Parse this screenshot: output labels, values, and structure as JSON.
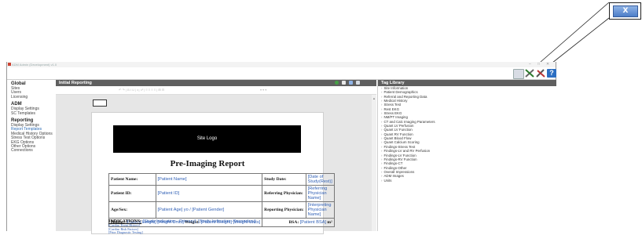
{
  "callout": {
    "close_label": "X"
  },
  "window": {
    "title": "ADM Admin (Development) v1.0",
    "minimize": "–",
    "maximize": "□",
    "close": "✕"
  },
  "toolbar": {
    "icons": [
      "save-icon",
      "tools-icon",
      "settings-icon",
      "help-icon"
    ],
    "help_label": "?"
  },
  "sidebar": {
    "sections": [
      {
        "title": "Global",
        "items": [
          "Sites",
          "Users",
          "Licensing"
        ]
      },
      {
        "title": "ADM",
        "items": [
          "Display Settings",
          "SC Templates"
        ]
      },
      {
        "title": "Reporting",
        "items": [
          "Display Settings",
          "Report Templates",
          "Medical History Options",
          "Stress Test Options",
          "EKG Options",
          "Other Options",
          "Connections"
        ]
      }
    ]
  },
  "editor": {
    "title": "Initial Reporting",
    "toolbar_text": "↶  ↷  |  B  I  U  |  x₂  x²  |  ≡  ≡  ≡  ≡  |  ⊞  ⊟",
    "toolbar_right": "▾     ▾  ▾",
    "logo_label": "Site Logo",
    "report_title": "Pre-Imaging Report",
    "rows": [
      [
        "Patient Name:",
        "[Patient Name]",
        "Study Date:",
        "[Date of Study(Rest)]"
      ],
      [
        "Patient ID:",
        "[Patient ID]",
        "Referring Physician:",
        "[Referring Physician Name]"
      ],
      [
        "Age/Sex:",
        "[Patient Age] yo / [Patient Gender]",
        "Reporting Physician:",
        "[Interpreting Physician Name]"
      ]
    ],
    "height_label": "Height:",
    "height_value": "[Patient Height] [Height Units]",
    "weight_label": "Weight:",
    "weight_value": "[Patient Weight] [Weight Units]",
    "bsa_label": "BSA:",
    "bsa_value": "[Patient BSA]",
    "bsa_unit": "m²",
    "indications_heading": "INDICATIONS:",
    "indications_value": "[Study Indication - Primary]; [Study Indication -Secondary]",
    "sub_items": [
      "[Cardiac Event History]",
      "[Cardiac Risk Factors]",
      "[Prior Diagnostic Testing]"
    ]
  },
  "tag_library": {
    "title": "Tag Library",
    "items": [
      "Site Information",
      "Patient Demographics",
      "Referral and Reporting Data",
      "Medical History",
      "Stress Test",
      "Rest EKG",
      "Stress EKG",
      "NM/PT Imaging",
      "CT and Calc Imaging Parameters",
      "Quant LV Perfusion",
      "Quant LV Function",
      "Quant RV Function",
      "Quant Blood Flow",
      "Quant Calcium Scoring",
      "Findings-Stress Test",
      "Findings-LV and RV Perfusion",
      "Findings-LV Function",
      "Findings-RV Function",
      "Findings-CT",
      "Findings-Other",
      "Overall Impressions",
      "ADM Images",
      "Units"
    ]
  },
  "colors": {
    "accent": "#2e6db5",
    "header_bar": "#5f5f5f",
    "tag_blue": "#2f5fb5"
  }
}
